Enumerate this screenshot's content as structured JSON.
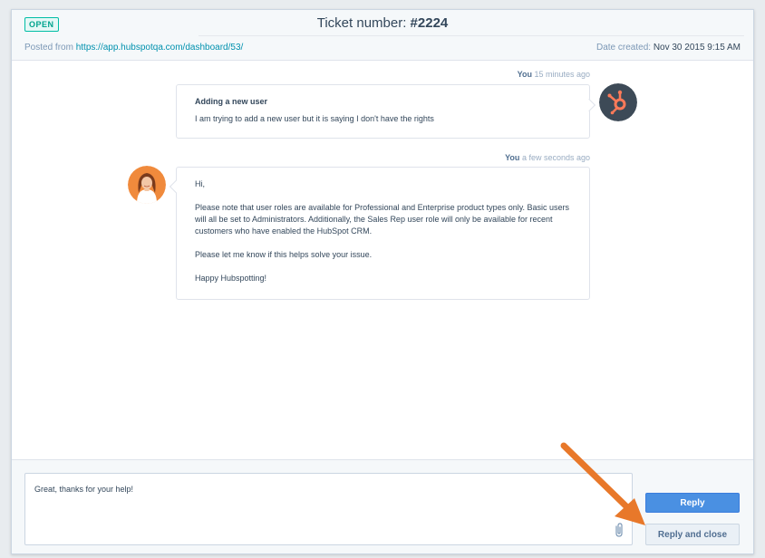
{
  "ticket": {
    "status": "OPEN",
    "title_prefix": "Ticket number: ",
    "number": "#2224",
    "posted_from_label": "Posted from ",
    "posted_from_url": "https://app.hubspotqa.com/dashboard/53/",
    "date_created_label": "Date created: ",
    "date_created_value": "Nov 30 2015 9:15 AM"
  },
  "messages": [
    {
      "author": "You",
      "time": " 15 minutes ago",
      "subject": "Adding a new user",
      "body": "I am trying to add a new user but it is saying I don't have the rights",
      "avatar": "hubspot-logo"
    },
    {
      "author": "You",
      "time": " a few seconds ago",
      "paragraphs": [
        "Hi,",
        "Please note that user roles are available for Professional and Enterprise product types only. Basic users will all be set to Administrators. Additionally, the Sales Rep user role will only be available for recent customers who have enabled the HubSpot CRM.",
        "Please let me know if this helps solve your issue.",
        "Happy Hubspotting!"
      ],
      "avatar": "agent-photo"
    }
  ],
  "composer": {
    "value": "Great, thanks for your help!",
    "attach_icon": "paperclip-icon"
  },
  "actions": {
    "reply_label": "Reply",
    "reply_close_label": "Reply and close"
  },
  "colors": {
    "accent_blue": "#4a90e2",
    "hubspot_orange": "#ff7a59",
    "annotation_arrow": "#e8782a",
    "open_badge": "#00bda5"
  }
}
